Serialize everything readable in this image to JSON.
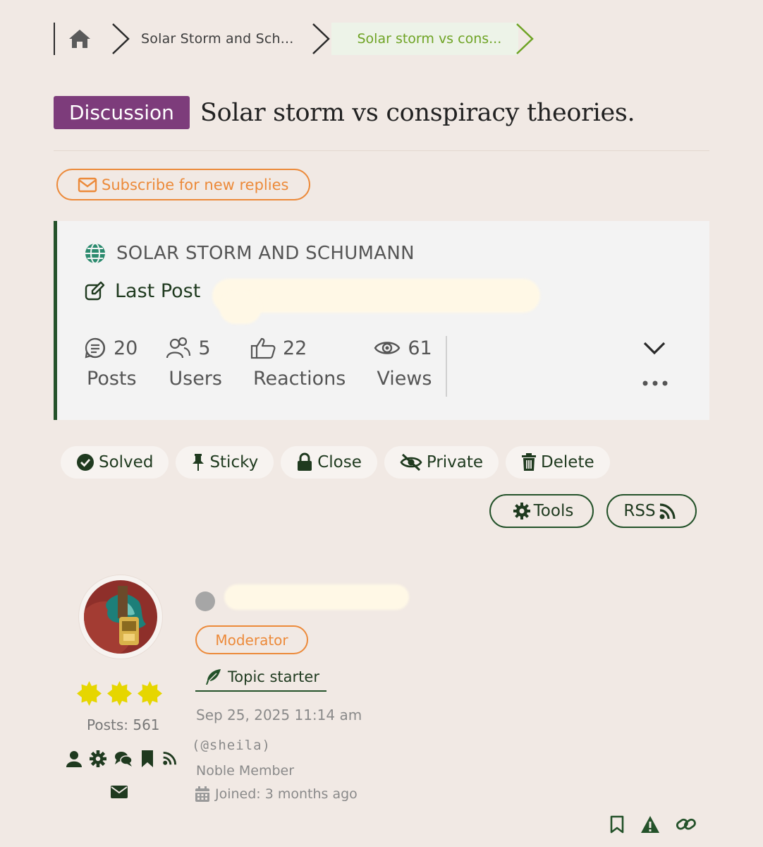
{
  "breadcrumb": {
    "home_icon": "home-icon",
    "items": [
      "Solar Storm and Sch...",
      "Solar storm vs cons..."
    ]
  },
  "topic": {
    "badge": "Discussion",
    "title": "Solar storm vs conspiracy theories."
  },
  "subscribe": {
    "label": "Subscribe for new replies"
  },
  "info": {
    "forum_name": "SOLAR STORM AND SCHUMANN",
    "last_post_label": "Last Post",
    "stats": [
      {
        "value": "20",
        "label": "Posts",
        "icon": "posts-icon"
      },
      {
        "value": "5",
        "label": "Users",
        "icon": "users-icon"
      },
      {
        "value": "22",
        "label": "Reactions",
        "icon": "thumbs-up-icon"
      },
      {
        "value": "61",
        "label": "Views",
        "icon": "eye-icon"
      }
    ]
  },
  "actions": {
    "solved": "Solved",
    "sticky": "Sticky",
    "close": "Close",
    "private": "Private",
    "delete": "Delete",
    "tools": "Tools",
    "rss": "RSS"
  },
  "author": {
    "posts": "Posts: 561",
    "role": "Moderator",
    "topic_starter": "Topic starter",
    "date": "Sep 25, 2025 11:14 am",
    "username": "(@sheila)",
    "rank": "Noble Member",
    "joined": "Joined: 3 months ago"
  },
  "colors": {
    "background": "#f1e9e4",
    "accent_green": "#24522a",
    "accent_orange": "#ec8a3a",
    "badge_purple": "#7d3c7b",
    "breadcrumb_green": "#6ea324",
    "star_yellow": "#e6d600"
  }
}
